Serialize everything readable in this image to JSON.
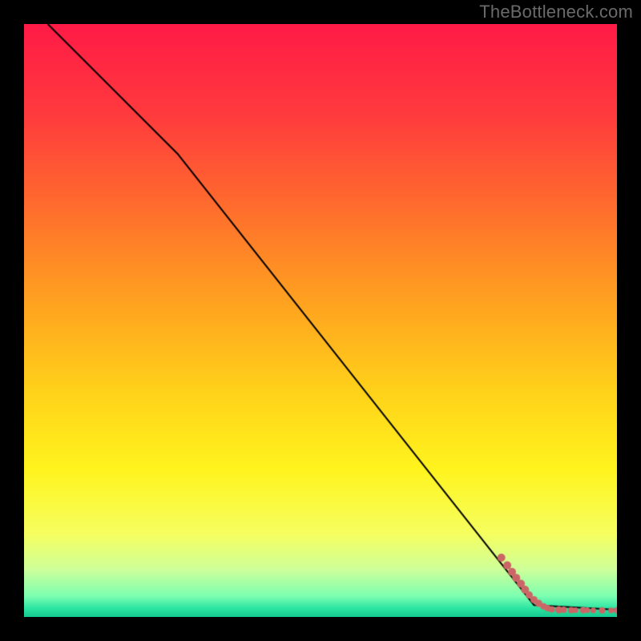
{
  "watermark": "TheBottleneck.com",
  "layout": {
    "canvas_size": 800,
    "plot_inset": 30,
    "plot_size": 740
  },
  "gradient": {
    "stops": [
      {
        "pos": 0.0,
        "color": "#ff1b47"
      },
      {
        "pos": 0.15,
        "color": "#ff3a3e"
      },
      {
        "pos": 0.3,
        "color": "#ff6a2e"
      },
      {
        "pos": 0.48,
        "color": "#ffa61f"
      },
      {
        "pos": 0.62,
        "color": "#ffd21a"
      },
      {
        "pos": 0.75,
        "color": "#fff41e"
      },
      {
        "pos": 0.86,
        "color": "#f6ff60"
      },
      {
        "pos": 0.92,
        "color": "#ceff9a"
      },
      {
        "pos": 0.965,
        "color": "#7dffb1"
      },
      {
        "pos": 0.985,
        "color": "#2de6a3"
      },
      {
        "pos": 1.0,
        "color": "#14c98f"
      }
    ]
  },
  "chart_data": {
    "type": "line",
    "title": "",
    "xlabel": "",
    "ylabel": "",
    "xlim": [
      0,
      100
    ],
    "ylim": [
      0,
      100
    ],
    "grid": false,
    "series": [
      {
        "name": "curve",
        "color": "#000000",
        "stroke_width": 2,
        "points": [
          {
            "x": 4,
            "y": 100
          },
          {
            "x": 26,
            "y": 78
          },
          {
            "x": 86,
            "y": 2
          },
          {
            "x": 100,
            "y": 1.2
          }
        ]
      }
    ],
    "markers": {
      "name": "points",
      "color": "#cc6666",
      "radius_base": 4.5,
      "points": [
        {
          "x": 80.5,
          "y": 10.0,
          "r": 5.0
        },
        {
          "x": 81.5,
          "y": 8.7,
          "r": 5.0
        },
        {
          "x": 82.3,
          "y": 7.6,
          "r": 5.0
        },
        {
          "x": 83.0,
          "y": 6.6,
          "r": 5.0
        },
        {
          "x": 83.8,
          "y": 5.6,
          "r": 5.0
        },
        {
          "x": 84.5,
          "y": 4.6,
          "r": 5.0
        },
        {
          "x": 85.2,
          "y": 3.7,
          "r": 4.5
        },
        {
          "x": 86.0,
          "y": 2.9,
          "r": 4.5
        },
        {
          "x": 86.8,
          "y": 2.3,
          "r": 4.5
        },
        {
          "x": 87.6,
          "y": 1.8,
          "r": 4.0
        },
        {
          "x": 88.3,
          "y": 1.5,
          "r": 4.0
        },
        {
          "x": 89.0,
          "y": 1.3,
          "r": 4.0
        },
        {
          "x": 90.2,
          "y": 1.2,
          "r": 4.5
        },
        {
          "x": 91.0,
          "y": 1.2,
          "r": 4.0
        },
        {
          "x": 92.3,
          "y": 1.15,
          "r": 4.0
        },
        {
          "x": 93.0,
          "y": 1.15,
          "r": 3.5
        },
        {
          "x": 94.3,
          "y": 1.15,
          "r": 4.0
        },
        {
          "x": 95.0,
          "y": 1.15,
          "r": 3.5
        },
        {
          "x": 96.0,
          "y": 1.1,
          "r": 3.5
        },
        {
          "x": 97.5,
          "y": 1.1,
          "r": 4.0
        },
        {
          "x": 99.0,
          "y": 1.1,
          "r": 3.5
        },
        {
          "x": 100.0,
          "y": 1.1,
          "r": 4.0
        }
      ]
    }
  }
}
